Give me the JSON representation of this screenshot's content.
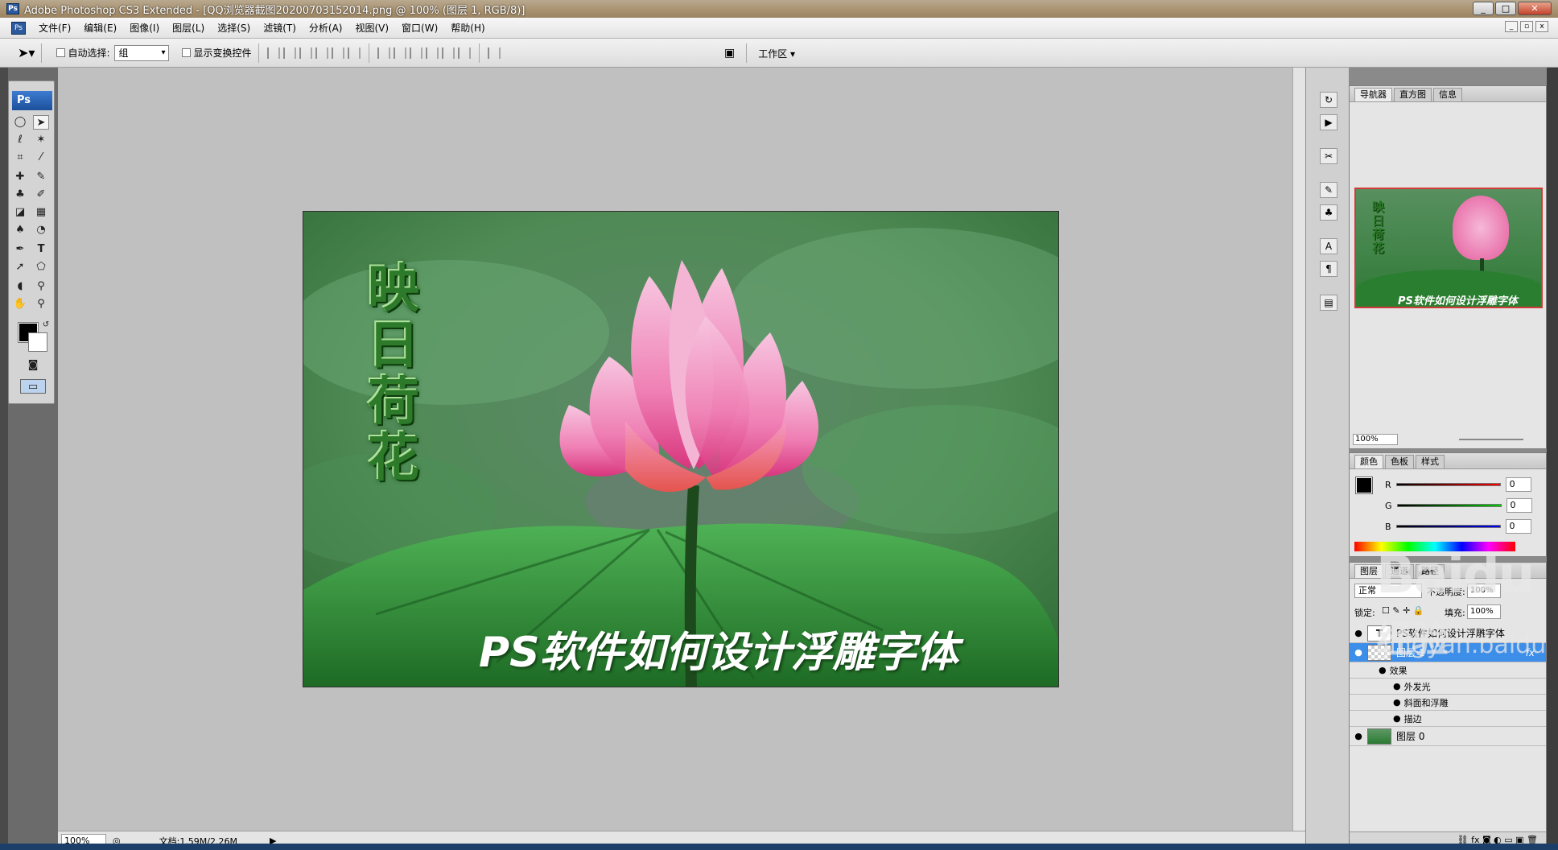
{
  "window": {
    "title": "Adobe Photoshop CS3 Extended - [QQ浏览器截图20200703152014.png @ 100% (图层 1, RGB/8)]",
    "min": "_",
    "max": "□",
    "close": "✕"
  },
  "menu": [
    "文件(F)",
    "编辑(E)",
    "图像(I)",
    "图层(L)",
    "选择(S)",
    "滤镜(T)",
    "分析(A)",
    "视图(V)",
    "窗口(W)",
    "帮助(H)"
  ],
  "options": {
    "auto_select": "自动选择:",
    "auto_select_value": "组",
    "show_transform": "显示变换控件",
    "workspace": "工作区 ▾"
  },
  "toolbox": {
    "logo": "Ps"
  },
  "canvas": {
    "vertical_text": [
      "映",
      "日",
      "荷",
      "花"
    ],
    "caption": "PS软件如何设计浮雕字体"
  },
  "status": {
    "zoom": "100%",
    "doc": "文档:1.59M/2.26M"
  },
  "navigator": {
    "tabs": [
      "导航器",
      "直方图",
      "信息"
    ],
    "zoom": "100%",
    "thumb_text_vertical": "映日荷花",
    "thumb_caption": "PS软件如何设计浮雕字体"
  },
  "color": {
    "tabs": [
      "颜色",
      "色板",
      "样式"
    ],
    "r_label": "R",
    "g_label": "G",
    "b_label": "B",
    "r": "0",
    "g": "0",
    "b": "0"
  },
  "layers": {
    "tabs": [
      "图层",
      "通道",
      "路径"
    ],
    "blend": "正常",
    "opacity_label": "不透明度:",
    "opacity": "100%",
    "lock_label": "锁定:",
    "fill_label": "填充:",
    "fill": "100%",
    "items": [
      {
        "name": "PS软件如何设计浮雕字体",
        "thumb": "T"
      },
      {
        "name": "图层 1",
        "fx": "fx"
      },
      {
        "name": "效果"
      },
      {
        "name": "外发光"
      },
      {
        "name": "斜面和浮雕"
      },
      {
        "name": "描边"
      },
      {
        "name": "图层 0"
      }
    ]
  },
  "watermark": {
    "brand": "Baidu",
    "sub": "经验",
    "url": "jingyan.baidu.com"
  }
}
